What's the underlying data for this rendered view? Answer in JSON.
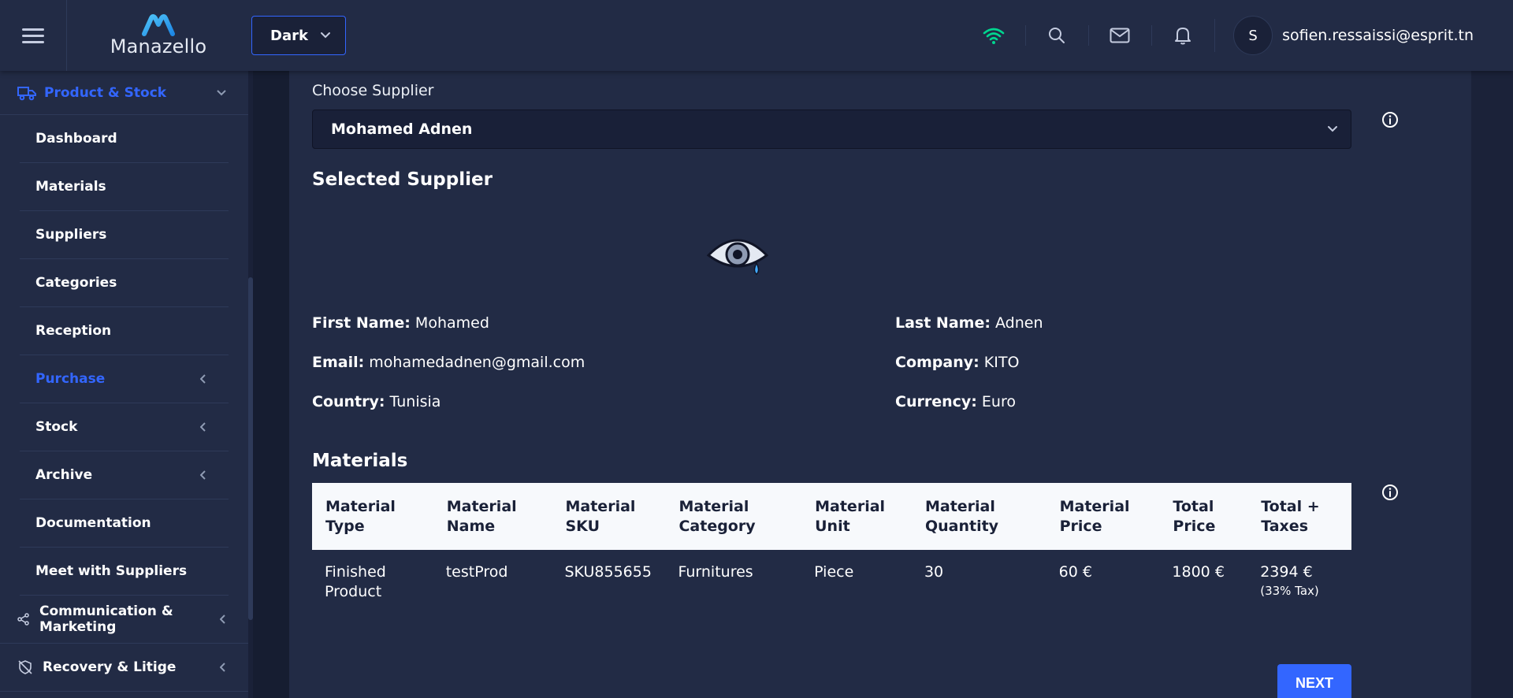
{
  "header": {
    "logo_text": "Manazello",
    "theme_value": "Dark",
    "user_initial": "S",
    "user_email": "sofien.ressaissi@esprit.tn",
    "icons": [
      "wifi-icon",
      "search-icon",
      "mail-icon",
      "bell-icon"
    ],
    "accent_color": "#3366ff",
    "wifi_color": "#00d68f"
  },
  "sidebar": {
    "top_item": {
      "label": "Product & Stock",
      "icon": "truck-icon"
    },
    "items": [
      {
        "label": "Dashboard"
      },
      {
        "label": "Materials"
      },
      {
        "label": "Suppliers"
      },
      {
        "label": "Categories"
      },
      {
        "label": "Reception"
      },
      {
        "label": "Purchase"
      },
      {
        "label": "Stock"
      },
      {
        "label": "Archive"
      },
      {
        "label": "Documentation"
      },
      {
        "label": "Meet with Suppliers"
      }
    ],
    "groups": [
      {
        "label": "Communication & Marketing",
        "icon": "share-icon"
      },
      {
        "label": "Recovery & Litige",
        "icon": "shield-off-icon"
      }
    ]
  },
  "main": {
    "choose_label": "Choose Supplier",
    "selected_supplier": "Mohamed Adnen",
    "selected_title": "Selected Supplier",
    "details": {
      "first_name_label": "First Name:",
      "first_name": "Mohamed",
      "last_name_label": "Last Name:",
      "last_name": "Adnen",
      "email_label": "Email:",
      "email": "mohamedadnen@gmail.com",
      "company_label": "Company:",
      "company": "KITO",
      "country_label": "Country:",
      "country": "Tunisia",
      "currency_label": "Currency:",
      "currency": "Euro"
    },
    "materials_title": "Materials",
    "table": {
      "headers": [
        "Material Type",
        "Material Name",
        "Material SKU",
        "Material Category",
        "Material Unit",
        "Material Quantity",
        "Material Price",
        "Total Price",
        "Total + Taxes"
      ],
      "rows": [
        [
          "Finished Product",
          "testProd",
          "SKU855655",
          "Furnitures",
          "Piece",
          "30",
          "60 €",
          "1800 €",
          "2394 €"
        ]
      ],
      "tax_note": "(33% Tax)"
    },
    "next_label": "NEXT"
  }
}
